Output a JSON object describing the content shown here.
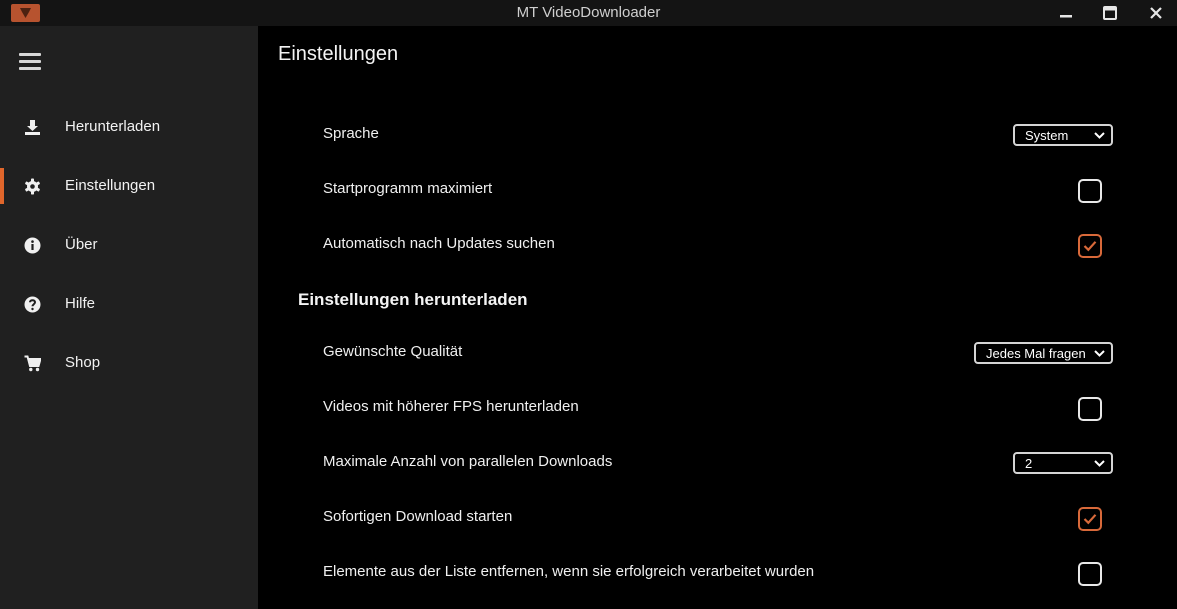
{
  "window": {
    "title": "MT VideoDownloader"
  },
  "sidebar": {
    "items": [
      {
        "label": "Herunterladen",
        "icon": "download-icon",
        "active": false
      },
      {
        "label": "Einstellungen",
        "icon": "gear-icon",
        "active": true
      },
      {
        "label": "Über",
        "icon": "info-icon",
        "active": false
      },
      {
        "label": "Hilfe",
        "icon": "help-icon",
        "active": false
      },
      {
        "label": "Shop",
        "icon": "cart-icon",
        "active": false
      }
    ]
  },
  "main": {
    "title": "Einstellungen",
    "general": {
      "language": {
        "label": "Sprache",
        "value": "System"
      },
      "start_maximized": {
        "label": "Startprogramm maximiert",
        "checked": false
      },
      "auto_updates": {
        "label": "Automatisch nach Updates suchen",
        "checked": true
      }
    },
    "download_section_title": "Einstellungen herunterladen",
    "download": {
      "quality": {
        "label": "Gewünschte Qualität",
        "value": "Jedes Mal fragen"
      },
      "high_fps": {
        "label": "Videos mit höherer FPS herunterladen",
        "checked": false
      },
      "parallel": {
        "label": "Maximale Anzahl von parallelen Downloads",
        "value": "2"
      },
      "instant_start": {
        "label": "Sofortigen Download starten",
        "checked": true
      },
      "remove_done": {
        "label": "Elemente aus der Liste entfernen, wenn sie erfolgreich verarbeitet wurden",
        "checked": false
      }
    }
  },
  "colors": {
    "accent": "#e0662b",
    "sidebar_bg": "#202020",
    "main_bg": "#000000",
    "checkbox_checked": "#d8693a"
  }
}
